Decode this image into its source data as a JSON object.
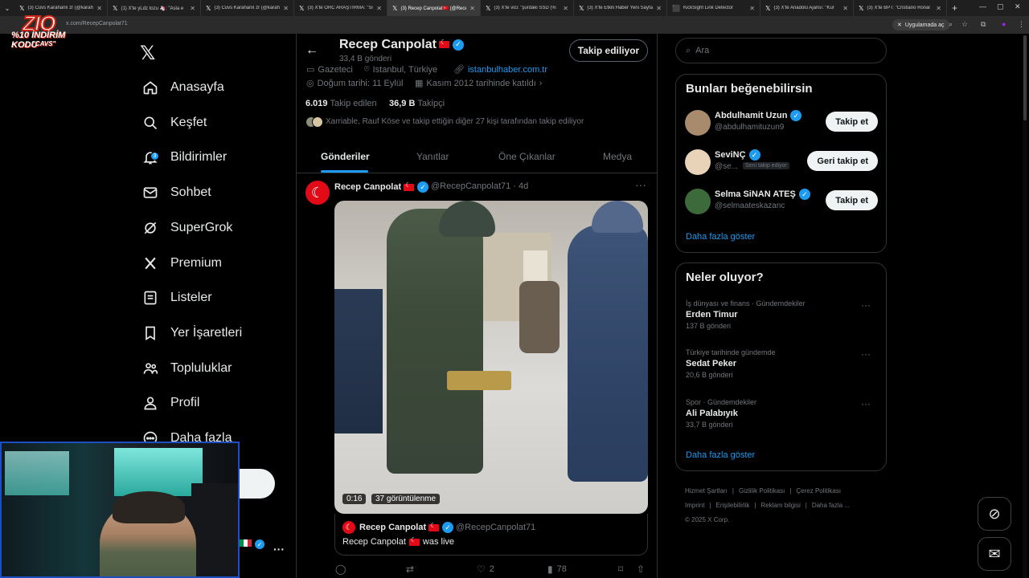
{
  "browser": {
    "tabs": [
      {
        "icon": "𝕏",
        "title": "(3) Cüvs Karahanlı zr (@karah",
        "active": false
      },
      {
        "icon": "𝕏",
        "title": "(1) X'te yLdz tozu 🦄: \"Asla e",
        "active": false
      },
      {
        "icon": "𝕏",
        "title": "(3) Cüvs Karahanlı zr (@karah",
        "active": false
      },
      {
        "icon": "𝕏",
        "title": "(3) X'te ORC ARAŞTIRMA: \"Si",
        "active": false
      },
      {
        "icon": "𝕏",
        "title": "(3) Recep Canpolat🇹🇷 (@Recep",
        "active": true
      },
      {
        "icon": "𝕏",
        "title": "(3) X'te vici: \"şurdaki SSD (%",
        "active": false
      },
      {
        "icon": "𝕏",
        "title": "(3) X'te Etkili Haber Yeni Sayfa",
        "active": false
      },
      {
        "icon": "⬛",
        "title": "KickSight Link Detector",
        "active": false
      },
      {
        "icon": "𝕏",
        "title": "(3) X'te Anadolu Ajansı: \"Kur",
        "active": false
      },
      {
        "icon": "𝕏",
        "title": "(3) X'te BPT: \"Cristiano Ronal",
        "active": false
      }
    ],
    "url": "x.com/RecepCanpolat71",
    "app_button": "Uygulamada aç"
  },
  "overlay": {
    "logo_text": "ZIO",
    "promo": "%10 İNDİRİM KODU",
    "code": "\"CAVS\""
  },
  "nav": {
    "items": [
      {
        "label": "Anasayfa",
        "icon": "home-icon"
      },
      {
        "label": "Keşfet",
        "icon": "search-icon"
      },
      {
        "label": "Bildirimler",
        "icon": "bell-icon",
        "badge": "3"
      },
      {
        "label": "Sohbet",
        "icon": "mail-icon"
      },
      {
        "label": "SuperGrok",
        "icon": "grok-icon"
      },
      {
        "label": "Premium",
        "icon": "x-premium-icon"
      },
      {
        "label": "Listeler",
        "icon": "list-icon"
      },
      {
        "label": "Yer İşaretleri",
        "icon": "bookmark-icon"
      },
      {
        "label": "Topluluklar",
        "icon": "communities-icon"
      },
      {
        "label": "Profil",
        "icon": "profile-icon"
      },
      {
        "label": "Daha fazla",
        "icon": "more-circle-icon"
      }
    ],
    "post_button_label": "a"
  },
  "profile": {
    "name": "Recep Canpolat",
    "post_count": "33,4 B gönderi",
    "follow_button": "Takip ediliyor",
    "job": "Gazeteci",
    "location": "Istanbul, Türkiye",
    "website": "istanbulhaber.com.tr",
    "birthday": "Doğum tarihi: 11 Eylül",
    "joined": "Kasım 2012 tarihinde katıldı",
    "following_count": "6.019",
    "following_label": "Takip edilen",
    "followers_count": "36,9 B",
    "followers_label": "Takipçi",
    "followed_by": "Xarriable, Rauf Köse ve takip ettiğin diğer 27 kişi tarafından takip ediliyor",
    "tabs": [
      "Gönderiler",
      "Yanıtlar",
      "Öne Çıkanlar",
      "Medya"
    ]
  },
  "tweet": {
    "name": "Recep Canpolat",
    "handle": "@RecepCanpolat71",
    "time": "4d",
    "video_time": "0:16",
    "video_views": "37 görüntülenme",
    "quote_name": "Recep Canpolat",
    "quote_handle": "@RecepCanpolat71",
    "quote_text_before": "Recep Canpolat",
    "quote_text_after": "was live",
    "likes": "2",
    "views": "78"
  },
  "sidebar": {
    "search_placeholder": "Ara",
    "suggest_title": "Bunları beğenebilirsin",
    "suggestions": [
      {
        "name": "Abdulhamit Uzun",
        "handle": "@abdulhamituzun9",
        "button": "Takip et",
        "follows_you": "",
        "color": "#a88a6c"
      },
      {
        "name": "SeviNÇ",
        "handle": "@se...",
        "button": "Geri takip et",
        "follows_you": "Seni takip ediyor",
        "color": "#e9d3b8"
      },
      {
        "name": "Selma SiNAN ATEŞ",
        "handle": "@selmaateskazanc",
        "button": "Takip et",
        "follows_you": "",
        "color": "#3c6a3a"
      }
    ],
    "show_more": "Daha fazla göster",
    "trends_title": "Neler oluyor?",
    "trends": [
      {
        "context": "İş dünyası ve finans · Gündemdekiler",
        "title": "Erden Timur",
        "count": "137 B gönderi"
      },
      {
        "context": "Türkiye tarihinde gündemde",
        "title": "Sedat Peker",
        "count": "20,6 B gönderi"
      },
      {
        "context": "Spor · Gündemdekiler",
        "title": "Ali Palabıyık",
        "count": "33,7 B gönderi"
      }
    ],
    "trends_more": "Daha fazla göster",
    "footer": [
      "Hizmet Şartları",
      "Gizlilik Politikası",
      "Çerez Politikası",
      "Imprint",
      "Erişilebilirlik",
      "Reklam bilgisi",
      "Daha fazla ...",
      "© 2025 X Corp."
    ]
  },
  "colors": {
    "accent": "#1d9bf0",
    "background": "#000000",
    "border": "#2f3336"
  }
}
